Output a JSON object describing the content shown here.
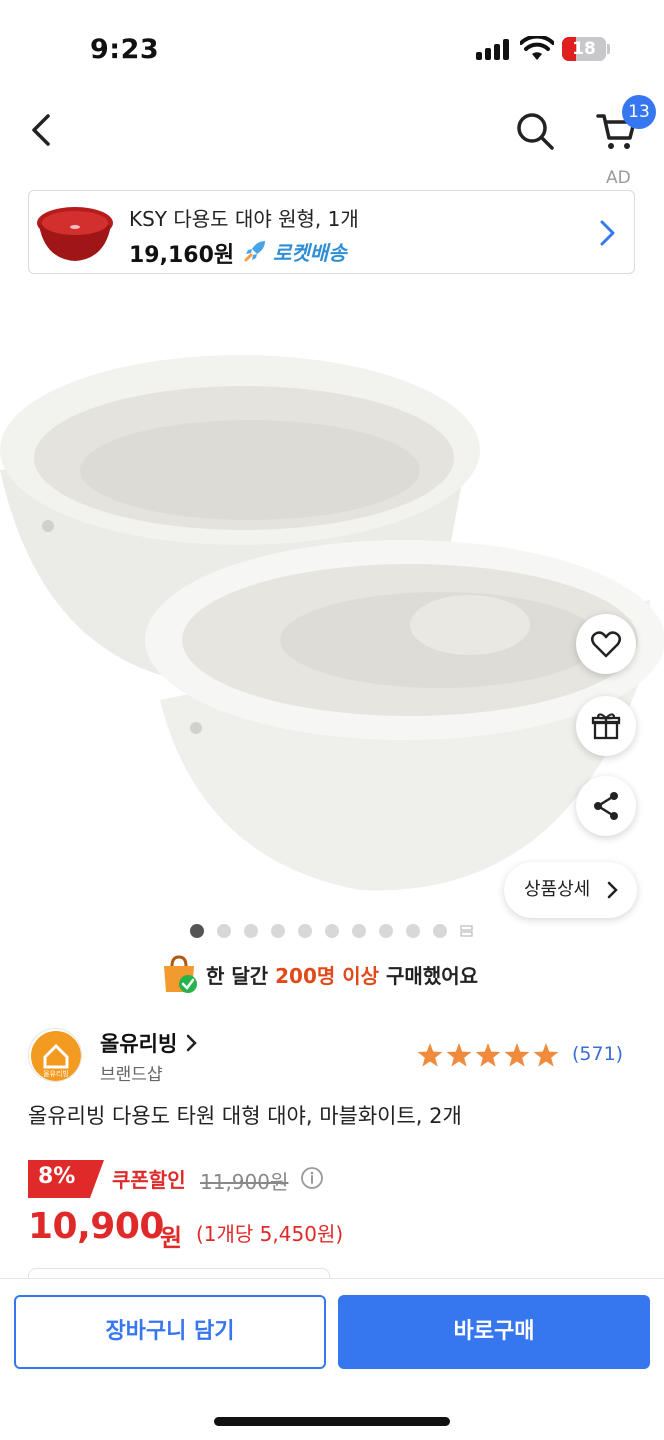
{
  "status_bar": {
    "time": "9:23",
    "battery": "18"
  },
  "header": {
    "cart_count": "13",
    "ad_label": "AD"
  },
  "ad_banner": {
    "title": "KSY 다용도 대야 원형, 1개",
    "price": "19,160원",
    "delivery": "로켓배송"
  },
  "product_image": {
    "detail_button": "상품상세",
    "dots_count": 10,
    "active_dot": 0
  },
  "purchase_note": {
    "prefix": "한 달간 ",
    "highlight": "200명 이상",
    "suffix": " 구매했어요"
  },
  "brand": {
    "name": "올유리빙",
    "logo_text": "올유리빙",
    "subtitle": "브랜드샵"
  },
  "rating": {
    "stars": 5,
    "review_count": "(571)"
  },
  "product": {
    "title": "올유리빙 다용도 타원 대형 대야, 마블화이트, 2개"
  },
  "price": {
    "discount": "8%",
    "coupon_label": "쿠폰할인",
    "original": "11,900원",
    "sale_number": "10,900",
    "sale_unit": "원",
    "unit_price": "(1개당 5,450원)"
  },
  "bottom_bar": {
    "cart_button": "장바구니 담기",
    "buy_button": "바로구매"
  },
  "colors": {
    "accent": "#3677f0",
    "sale_red": "#e02a2a",
    "star_orange": "#f08a3c",
    "review_blue": "#3b6fd6"
  }
}
